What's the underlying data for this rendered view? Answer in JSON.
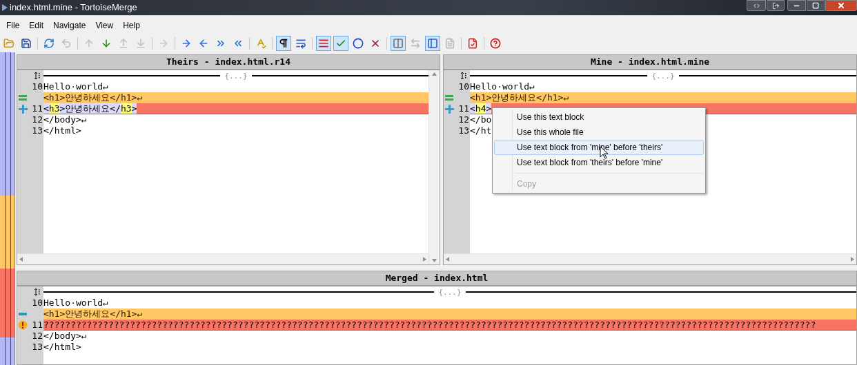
{
  "window": {
    "title": "index.html.mine - TortoiseMerge"
  },
  "menu_bar": [
    "File",
    "Edit",
    "Navigate",
    "View",
    "Help"
  ],
  "toolbar": [
    {
      "kind": "button",
      "pressed": false,
      "disabled": false
    },
    {
      "kind": "button",
      "pressed": false,
      "disabled": false
    },
    {
      "kind": "separator"
    },
    {
      "kind": "button",
      "pressed": false,
      "disabled": false
    },
    {
      "kind": "button",
      "pressed": false,
      "disabled": true
    },
    {
      "kind": "separator"
    },
    {
      "kind": "button",
      "pressed": false,
      "disabled": true
    },
    {
      "kind": "button",
      "pressed": false,
      "disabled": false
    },
    {
      "kind": "button",
      "pressed": false,
      "disabled": true
    },
    {
      "kind": "button",
      "pressed": false,
      "disabled": true
    },
    {
      "kind": "separator"
    },
    {
      "kind": "button",
      "pressed": false,
      "disabled": true
    },
    {
      "kind": "separator"
    },
    {
      "kind": "button",
      "pressed": false,
      "disabled": false
    },
    {
      "kind": "button",
      "pressed": false,
      "disabled": false
    },
    {
      "kind": "button",
      "pressed": false,
      "disabled": false
    },
    {
      "kind": "button",
      "pressed": false,
      "disabled": false
    },
    {
      "kind": "separator"
    },
    {
      "kind": "button",
      "pressed": false,
      "disabled": false
    },
    {
      "kind": "separator"
    },
    {
      "kind": "button",
      "pressed": true,
      "disabled": false
    },
    {
      "kind": "button",
      "pressed": false,
      "disabled": false
    },
    {
      "kind": "separator"
    },
    {
      "kind": "button",
      "pressed": true,
      "disabled": false
    },
    {
      "kind": "button",
      "pressed": true,
      "disabled": false
    },
    {
      "kind": "button",
      "pressed": false,
      "disabled": false
    },
    {
      "kind": "button",
      "pressed": false,
      "disabled": false
    },
    {
      "kind": "separator"
    },
    {
      "kind": "button",
      "pressed": true,
      "disabled": false
    },
    {
      "kind": "button",
      "pressed": false,
      "disabled": true
    },
    {
      "kind": "button",
      "pressed": true,
      "disabled": false
    },
    {
      "kind": "button",
      "pressed": false,
      "disabled": true
    },
    {
      "kind": "separator"
    },
    {
      "kind": "button",
      "pressed": false,
      "disabled": false
    },
    {
      "kind": "separator"
    },
    {
      "kind": "button",
      "pressed": false,
      "disabled": false
    }
  ],
  "panes": [
    {
      "title": "Theirs - index.html.r14",
      "lines": [
        {
          "kind": "fold",
          "text": "{...}"
        },
        {
          "kind": "normal",
          "number": "10",
          "segments": [
            {
              "kind": "plain",
              "text": "Hello·world↵"
            }
          ]
        },
        {
          "kind": "removed",
          "marker": {
            "kind": "equal"
          },
          "segments": [
            {
              "kind": "plain",
              "text": "<h1>안녕하세요</h1>↵"
            }
          ]
        },
        {
          "kind": "conflict",
          "number": "11",
          "marker": {
            "kind": "plus"
          },
          "segments": [
            {
              "kind": "changed",
              "text": "<"
            },
            {
              "kind": "tag",
              "text": "h3"
            },
            {
              "kind": "changed",
              "text": ">안녕하세요</"
            },
            {
              "kind": "tag",
              "text": "h3"
            },
            {
              "kind": "changed",
              "text": ">"
            }
          ]
        },
        {
          "kind": "normal",
          "number": "12",
          "segments": [
            {
              "kind": "plain",
              "text": "</body>↵"
            }
          ]
        },
        {
          "kind": "normal",
          "number": "13",
          "segments": [
            {
              "kind": "plain",
              "text": "</html>"
            }
          ]
        }
      ]
    },
    {
      "title": "Mine - index.html.mine",
      "lines": [
        {
          "kind": "fold",
          "text": "{...}"
        },
        {
          "kind": "normal",
          "number": "10",
          "segments": [
            {
              "kind": "plain",
              "text": "Hello·world↵"
            }
          ]
        },
        {
          "kind": "removed",
          "marker": {
            "kind": "equal"
          },
          "segments": [
            {
              "kind": "plain",
              "text": "<h1>안녕하세요</h1>↵"
            }
          ]
        },
        {
          "kind": "conflict",
          "number": "11",
          "marker": {
            "kind": "plus"
          },
          "segments": [
            {
              "kind": "changed",
              "text": "<"
            },
            {
              "kind": "tag",
              "text": "h4"
            },
            {
              "kind": "changed",
              "text": ">"
            }
          ]
        },
        {
          "kind": "normal",
          "number": "12",
          "segments": [
            {
              "kind": "plain",
              "text": "</bo"
            }
          ]
        },
        {
          "kind": "normal",
          "number": "13",
          "segments": [
            {
              "kind": "plain",
              "text": "</ht"
            }
          ]
        }
      ]
    },
    {
      "title": "Merged - index.html",
      "lines": [
        {
          "kind": "fold",
          "text": "{...}"
        },
        {
          "kind": "normal",
          "number": "10",
          "segments": [
            {
              "kind": "plain",
              "text": "Hello·world↵"
            }
          ]
        },
        {
          "kind": "removed",
          "marker": {
            "kind": "minus"
          },
          "segments": [
            {
              "kind": "plain",
              "text": "<h1>안녕하세요</h1>↵"
            }
          ]
        },
        {
          "kind": "conflict",
          "number": "11",
          "marker": {
            "kind": "warning"
          },
          "segments": [
            {
              "kind": "plain",
              "text": "???????????????????????????????????????????????????????????????????????????????????????????????????????????????????????????????????????????????"
            }
          ]
        },
        {
          "kind": "normal",
          "number": "12",
          "segments": [
            {
              "kind": "plain",
              "text": "</body>↵"
            }
          ]
        },
        {
          "kind": "normal",
          "number": "13",
          "segments": [
            {
              "kind": "plain",
              "text": "</html>"
            }
          ]
        }
      ]
    }
  ],
  "context_menu": [
    {
      "label": "Use this text block",
      "selected": false,
      "disabled": false
    },
    {
      "label": "Use this whole file",
      "selected": false,
      "disabled": false
    },
    {
      "label": "Use text block from 'mine' before 'theirs'",
      "selected": true,
      "disabled": false
    },
    {
      "label": "Use text block from 'theirs' before 'mine'",
      "selected": false,
      "disabled": false
    },
    {
      "label": "Copy",
      "selected": false,
      "disabled": true,
      "separator_before": true
    }
  ]
}
